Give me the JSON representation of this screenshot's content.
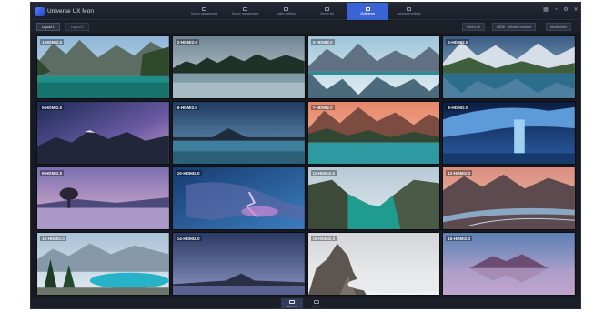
{
  "app": {
    "title": "Universe UX Mon"
  },
  "nav": {
    "items": [
      {
        "label": "Screen management",
        "active": false
      },
      {
        "label": "Source management",
        "active": false
      },
      {
        "label": "Matrix settings",
        "active": false
      },
      {
        "label": "Device list",
        "active": false
      },
      {
        "label": "Multiviewer",
        "active": true
      },
      {
        "label": "Advanced settings",
        "active": false
      }
    ]
  },
  "toolbar": {
    "tabs": [
      {
        "label": "Layout 1",
        "active": true
      },
      {
        "label": "Layout 2",
        "active": false
      }
    ],
    "controls": [
      "Select all",
      "HDMI · Window number",
      "Multiviewer"
    ]
  },
  "tiles": [
    "1-HDMI2.0",
    "2-HDMI2.0",
    "3-HDMI2.0",
    "4-HDMI2.0",
    "5-HDMI2.0",
    "6-HDMI2.0",
    "7-HDMI2.0",
    "8-HDMI2.0",
    "9-HDMI2.0",
    "10-HDMI2.0",
    "11-HDMI2.0",
    "12-HDMI2.0",
    "13-HDMI2.0",
    "14-HDMI2.0",
    "15-HDMI2.0",
    "16-HDMI2.0"
  ],
  "bottom": {
    "tabs": [
      {
        "label": "Preview",
        "active": true
      },
      {
        "label": "Screen",
        "active": false
      }
    ]
  },
  "colors": {
    "accent": "#3a63d6",
    "background": "#171a22"
  }
}
